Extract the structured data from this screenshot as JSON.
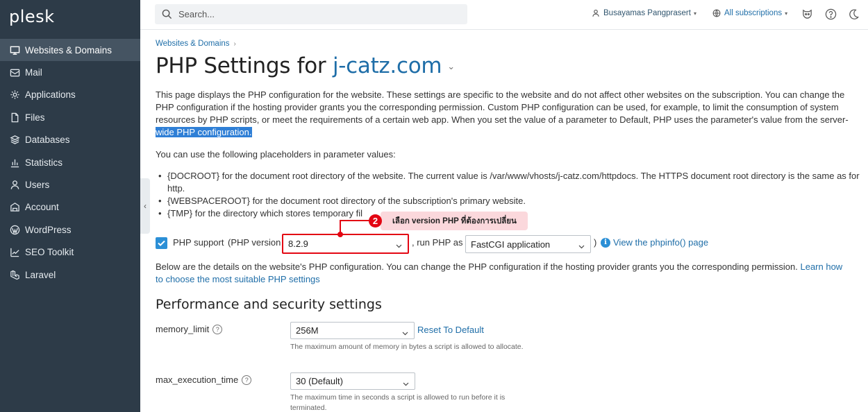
{
  "sidebar": {
    "logo": "plesk",
    "items": [
      {
        "label": "Websites & Domains",
        "icon": "monitor-icon",
        "active": true
      },
      {
        "label": "Mail",
        "icon": "mail-icon"
      },
      {
        "label": "Applications",
        "icon": "gear-icon"
      },
      {
        "label": "Files",
        "icon": "file-icon"
      },
      {
        "label": "Databases",
        "icon": "database-icon"
      },
      {
        "label": "Statistics",
        "icon": "chart-icon"
      },
      {
        "label": "Users",
        "icon": "user-icon"
      },
      {
        "label": "Account",
        "icon": "account-icon"
      },
      {
        "label": "WordPress",
        "icon": "wordpress-icon"
      },
      {
        "label": "SEO Toolkit",
        "icon": "seo-icon"
      },
      {
        "label": "Laravel",
        "icon": "laravel-icon"
      }
    ],
    "collapse_glyph": "‹"
  },
  "header": {
    "search_placeholder": "Search...",
    "user_name": "Busayamas Pangprasert",
    "subscriptions": "All subscriptions"
  },
  "breadcrumb": {
    "item": "Websites & Domains",
    "sep": "›"
  },
  "page": {
    "title_prefix": "PHP Settings for ",
    "title_domain": "j-catz.com",
    "title_dropdown": "⌄",
    "intro_main": "This page displays the PHP configuration for the website. These settings are specific to the website and do not affect other websites on the subscription. You can change the PHP configuration if the hosting provider grants you the corresponding permission. Custom PHP configuration can be used, for example, to limit the consumption of system resources by PHP scripts, or meet the requirements of a certain web app. When you set the value of a parameter to Default, PHP uses the parameter's value from the server-",
    "intro_highlight": "wide PHP configuration.",
    "placeholders_intro": "You can use the following placeholders in parameter values:",
    "placeholders": [
      "{DOCROOT} for the document root directory of the website. The current value is /var/www/vhosts/j-catz.com/httpdocs. The HTTPS document root directory is the same as for http.",
      "{WEBSPACEROOT} for the document root directory of the subscription's primary website.",
      "{TMP} for the directory which stores temporary fil"
    ],
    "php_support_label": "PHP support",
    "php_version_label": "(PHP version",
    "php_version_value": "8.2.9",
    "run_php_as_label": ", run PHP as",
    "run_php_as_value": "FastCGI application",
    "close_paren": ")",
    "info_glyph": "i",
    "phpinfo_link": "View the phpinfo() page",
    "details_text": "Below are the details on the website's PHP configuration. You can change the PHP configuration if the hosting provider grants you the corresponding permission.",
    "learn_link_1": "Learn how",
    "learn_link_2": "to choose the most suitable PHP settings",
    "section_title": "Performance and security settings",
    "fields": [
      {
        "name": "memory_limit",
        "value": "256M",
        "reset": "Reset To Default",
        "hint": "The maximum amount of memory in bytes a script is allowed to allocate."
      },
      {
        "name": "max_execution_time",
        "value": "30 (Default)",
        "hint": "The maximum time in seconds a script is allowed to run before it is terminated."
      }
    ],
    "help_glyph": "?"
  },
  "annotation": {
    "number": "2",
    "text": "เลือก version PHP ที่ต้องการเปลี่ยน"
  },
  "colors": {
    "sidebar_bg": "#2d3b48",
    "sidebar_active": "#455462",
    "link": "#1f6ea8",
    "checkbox": "#2b8fd6",
    "annotation_red": "#e30613",
    "annotation_pill": "#fbd8dc"
  }
}
